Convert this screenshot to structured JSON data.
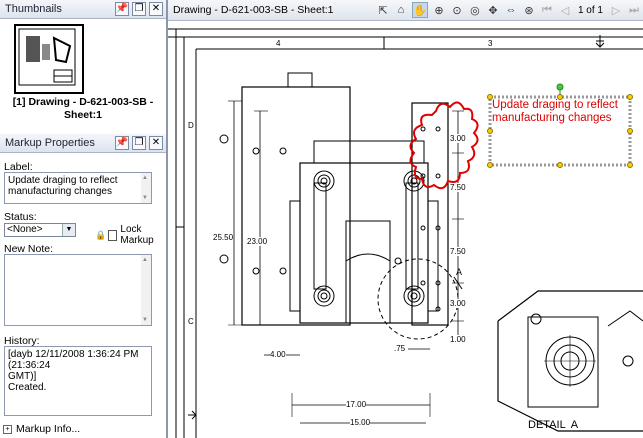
{
  "thumbnails": {
    "title": "Thumbnails",
    "caption_line1": "[1] Drawing - D-621-003-SB -",
    "caption_line2": "Sheet:1"
  },
  "markup_properties": {
    "title": "Markup Properties",
    "label_heading": "Label:",
    "label_value": "Update draging to reflect manufacturing changes",
    "status_heading": "Status:",
    "status_value": "<None>",
    "lock_label": "Lock Markup",
    "new_note_heading": "New Note:",
    "history_heading": "History:",
    "history_line1": "[dayb 12/11/2008 1:36:24 PM (21:36:24",
    "history_line2": "GMT)]",
    "history_line3": "Created.",
    "markup_info": "Markup Info..."
  },
  "document": {
    "title": "Drawing - D-621-003-SB - Sheet:1",
    "page_indicator": "1 of 1"
  },
  "drawing": {
    "markup_text_line1": "Update draging to reflect",
    "markup_text_line2": "manufacturing changes",
    "zone_top_4": "4",
    "zone_top_3": "3",
    "zone_left_d": "D",
    "zone_left_c": "C",
    "dim_2550": "25.50",
    "dim_2300": "23.00",
    "dim_300a": "3.00",
    "dim_750a": "7.50",
    "dim_750b": "7.50",
    "dim_300b": "3.00",
    "dim_100": "1.00",
    "dim_75": ".75",
    "dim_400": "4.00",
    "dim_1700": "17.00",
    "dim_1500": "15.00",
    "detail_letter": "A",
    "detail_label": "DETAIL  A"
  },
  "colors": {
    "markup_red": "#e00000",
    "panel_header": "#dde3ee"
  }
}
